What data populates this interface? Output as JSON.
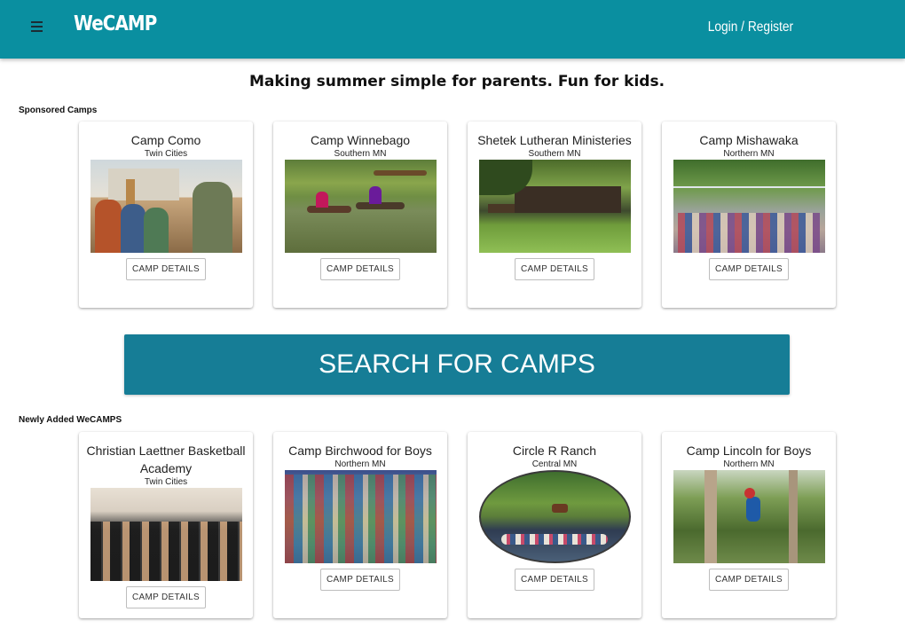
{
  "header": {
    "brand": "WeCAMP",
    "login_label": "Login / Register"
  },
  "tagline": "Making summer simple for parents. Fun for kids.",
  "sponsored": {
    "heading": "Sponsored Camps",
    "camps": [
      {
        "name": "Camp Como",
        "region": "Twin Cities",
        "button": "CAMP DETAILS"
      },
      {
        "name": "Camp Winnebago",
        "region": "Southern MN",
        "button": "CAMP DETAILS"
      },
      {
        "name": "Shetek Lutheran Ministeries",
        "region": "Southern MN",
        "button": "CAMP DETAILS"
      },
      {
        "name": "Camp Mishawaka",
        "region": "Northern MN",
        "button": "CAMP DETAILS"
      }
    ]
  },
  "search_button": "SEARCH FOR CAMPS",
  "newly_added": {
    "heading": "Newly Added WeCAMPS",
    "camps": [
      {
        "name": "Christian Laettner Basketball Academy",
        "region": "Twin Cities",
        "button": "CAMP DETAILS"
      },
      {
        "name": "Camp Birchwood for Boys",
        "region": "Northern MN",
        "button": "CAMP DETAILS"
      },
      {
        "name": "Circle R Ranch",
        "region": "Central MN",
        "button": "CAMP DETAILS"
      },
      {
        "name": "Camp Lincoln for Boys",
        "region": "Northern MN",
        "button": "CAMP DETAILS"
      }
    ]
  },
  "icons": {
    "menu": "hamburger-menu-icon"
  },
  "colors": {
    "appbar": "#0a8fa0",
    "search_button": "#167d96"
  }
}
